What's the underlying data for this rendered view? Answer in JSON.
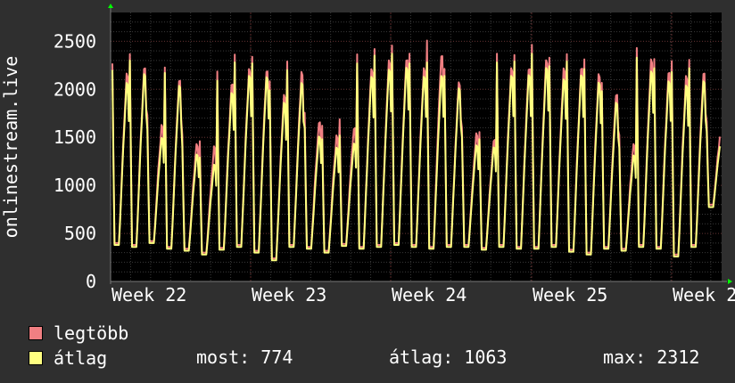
{
  "chart_data": {
    "type": "line",
    "ylabel": "onlinestream.live",
    "ylim": [
      0,
      2800
    ],
    "y_ticks": [
      0,
      500,
      1000,
      1500,
      2000,
      2500
    ],
    "x_tick_labels": [
      "Week 22",
      "Week 23",
      "Week 24",
      "Week 25",
      "Week 2"
    ],
    "grid": true,
    "series": [
      {
        "name": "legtöbb",
        "color": "#f07f82",
        "daily_peaks": [
          2270,
          2350,
          1700,
          2220,
          1500,
          1460,
          2170,
          2330,
          2330,
          2060,
          2290,
          1740,
          1590,
          1680,
          2340,
          2420,
          2440,
          2340,
          2500,
          2190,
          1600,
          1540,
          2340,
          2350,
          2440,
          2330,
          2350,
          2280,
          2060,
          1500,
          2430,
          2300,
          2260,
          2300,
          1640
        ],
        "daily_troughs": [
          400,
          380,
          420,
          360,
          340,
          300,
          350,
          380,
          320,
          240,
          380,
          360,
          320,
          390,
          360,
          380,
          400,
          380,
          360,
          380,
          380,
          350,
          380,
          360,
          360,
          380,
          330,
          300,
          360,
          340,
          380,
          360,
          280,
          380,
          800
        ]
      },
      {
        "name": "átlag",
        "color": "#ffff80",
        "daily_peaks": [
          2200,
          2300,
          1580,
          2170,
          1400,
          1290,
          2090,
          2280,
          2270,
          1990,
          2200,
          1600,
          1480,
          1520,
          2270,
          2350,
          2370,
          2270,
          2280,
          2140,
          1500,
          1480,
          2280,
          2290,
          2370,
          2240,
          2290,
          2210,
          1980,
          1390,
          2330,
          2220,
          2180,
          2220,
          1560
        ],
        "daily_troughs": [
          380,
          360,
          400,
          340,
          320,
          280,
          330,
          360,
          300,
          220,
          360,
          340,
          300,
          370,
          340,
          360,
          380,
          360,
          340,
          360,
          360,
          330,
          360,
          340,
          340,
          360,
          310,
          280,
          340,
          320,
          360,
          340,
          260,
          360,
          774
        ]
      }
    ]
  },
  "legend": [
    {
      "label": "legtöbb",
      "color": "#f07f82"
    },
    {
      "label": "átlag",
      "color": "#ffff80"
    }
  ],
  "stats": {
    "now": "most: 774",
    "avg": "átlag: 1063",
    "max": "max: 2312"
  },
  "colors": {
    "background": "#2f2f2f",
    "plot_background": "#000000",
    "grid_minor": "#3a3a3a",
    "grid_major": "#5a2a2a",
    "axis": "#7a7a7a",
    "arrow": "#00ff00"
  }
}
